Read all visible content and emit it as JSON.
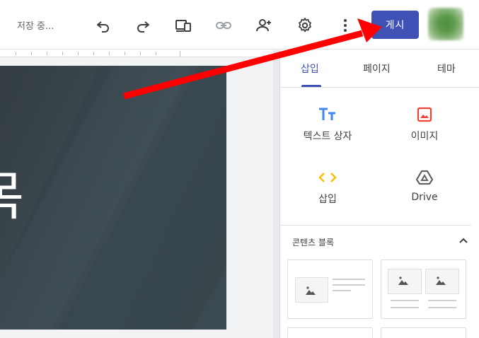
{
  "header": {
    "status": "저장 중...",
    "publish_label": "게시",
    "icons": [
      "undo-icon",
      "redo-icon",
      "preview-devices-icon",
      "link-icon",
      "share-person-add-icon",
      "settings-gear-icon",
      "more-vert-icon"
    ]
  },
  "canvas": {
    "hero_text": "목"
  },
  "panel": {
    "tabs": [
      {
        "label": "삽입",
        "active": true
      },
      {
        "label": "페이지",
        "active": false
      },
      {
        "label": "테마",
        "active": false
      }
    ],
    "insert_items": [
      {
        "label": "텍스트 상자",
        "icon": "text-box-icon"
      },
      {
        "label": "이미지",
        "icon": "image-icon"
      },
      {
        "label": "삽입",
        "icon": "embed-code-icon"
      },
      {
        "label": "Drive",
        "icon": "drive-icon"
      }
    ],
    "content_blocks_title": "콘텐츠 블록"
  },
  "colors": {
    "accent": "#3f51b5",
    "annotation_arrow": "#ff0000",
    "hero_bg": "#38444b"
  }
}
